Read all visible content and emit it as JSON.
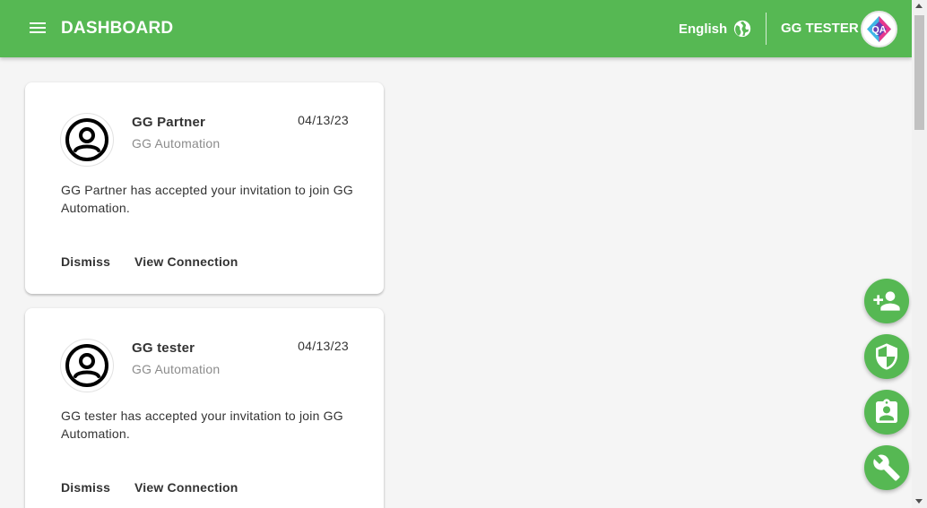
{
  "header": {
    "title": "DASHBOARD",
    "language": "English",
    "user_name": "GG TESTER",
    "logo_text": "QA"
  },
  "notifications": [
    {
      "name": "GG Partner",
      "org": "GG Automation",
      "date": "04/13/23",
      "message": "GG Partner has accepted your invitation to join GG Automation.",
      "dismiss_label": "Dismiss",
      "view_label": "View Connection"
    },
    {
      "name": "GG tester",
      "org": "GG Automation",
      "date": "04/13/23",
      "message": "GG tester has accepted your invitation to join GG Automation.",
      "dismiss_label": "Dismiss",
      "view_label": "View Connection"
    }
  ],
  "fab_actions": [
    {
      "icon": "person-add-icon"
    },
    {
      "icon": "shield-icon"
    },
    {
      "icon": "badge-icon"
    },
    {
      "icon": "wrench-icon"
    }
  ],
  "colors": {
    "primary": "#56b853",
    "background": "#f5f5f5",
    "card": "#ffffff"
  }
}
